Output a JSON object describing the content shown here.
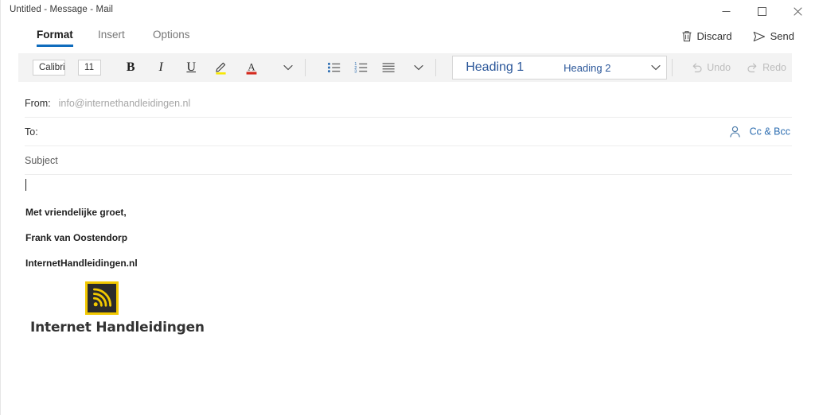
{
  "window": {
    "title": "Untitled - Message - Mail",
    "controls": {
      "minimize": "minimize-icon",
      "maximize": "maximize-icon",
      "close": "close-icon"
    }
  },
  "ribbon": {
    "tabs": [
      {
        "label": "Format",
        "active": true
      },
      {
        "label": "Insert",
        "active": false
      },
      {
        "label": "Options",
        "active": false
      }
    ],
    "actions": [
      {
        "label": "Discard",
        "icon": "trash-icon"
      },
      {
        "label": "Send",
        "icon": "send-icon"
      }
    ]
  },
  "toolbar": {
    "font_name": "Calibri (Body)",
    "font_size": "11",
    "bold_label": "B",
    "italic_label": "I",
    "underline_label": "U",
    "highlight_icon": "highlight-pen-icon",
    "font_color_icon": "font-color-icon",
    "more_font_icon": "chevron-down-icon",
    "bullet_list_icon": "bullet-list-icon",
    "numbered_list_icon": "numbered-list-icon",
    "align_icon": "align-left-icon",
    "more_paragraph_icon": "chevron-down-icon",
    "styles": {
      "heading1": "Heading 1",
      "heading2": "Heading 2",
      "expand_icon": "chevron-down-icon"
    },
    "undo": {
      "label": "Undo",
      "icon": "undo-icon",
      "disabled": true
    },
    "redo": {
      "label": "Redo",
      "icon": "redo-icon",
      "disabled": true
    },
    "colors": {
      "highlight": "#f7e705",
      "font_color": "#d42a1e",
      "accent": "#0f6cbd",
      "style_text": "#2b579a"
    }
  },
  "compose": {
    "from": {
      "label": "From:",
      "value": "info@internethandleidingen.nl"
    },
    "to": {
      "label": "To:",
      "value": "",
      "placeholder": ""
    },
    "cc_bcc": {
      "label": "Cc & Bcc",
      "icon": "person-icon"
    },
    "subject": {
      "label": "Subject",
      "value": ""
    },
    "body": {
      "cursor": true,
      "signature": [
        "Met vriendelijke groet,",
        "Frank van Oostendorp",
        "InternetHandleidingen.nl"
      ],
      "logo": {
        "icon": "rss-signal-icon",
        "text": "Internet Handleidingen",
        "border_color": "#f2c800",
        "background_color": "#2b2b2b",
        "wave_color": "#f2c800"
      }
    }
  }
}
